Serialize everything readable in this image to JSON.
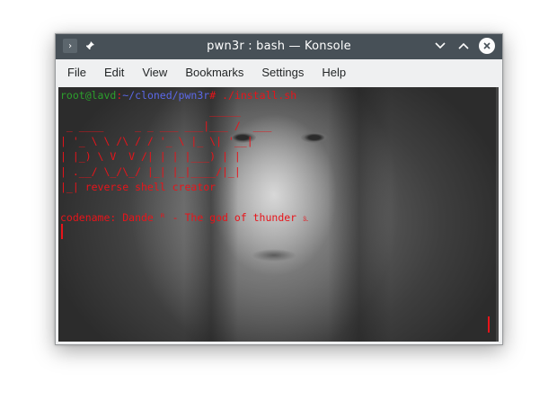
{
  "window": {
    "title": "pwn3r : bash — Konsole"
  },
  "titlebar": {
    "app_icon_glyph": "›",
    "pin_icon_glyph": "📌",
    "buttons": [
      "chevron-down-icon",
      "chevron-up-icon",
      "close-icon"
    ]
  },
  "menu": {
    "items": [
      "File",
      "Edit",
      "View",
      "Bookmarks",
      "Settings",
      "Help"
    ]
  },
  "terminal": {
    "prompt_user": "root@lavd",
    "prompt_sep": ":",
    "prompt_path": "~/cloned/pwn3r",
    "prompt_symbol": "#",
    "command": " ./install.sh",
    "banner_lines": [
      "                        _____",
      " _ ____     _ _ ___ ___|___ /  ___",
      "| '_ \\ \\ /\\ / / '_ \\ |_ \\| '__|",
      "| |_) \\ V  V /| | | |___) | |",
      "| .__/ \\_/\\_/ |_| |_|____/|_|",
      "|_| reverse shell creator"
    ],
    "blank_line": "",
    "codename_line": "codename: Dande ᴿ - The god of thunder ೩"
  },
  "colors": {
    "titlebar_bg": "#475057",
    "menubar_bg": "#eff0f1",
    "terminal_text": "#e8141a",
    "prompt_user": "#2ca02c",
    "prompt_path": "#5b68e8"
  }
}
